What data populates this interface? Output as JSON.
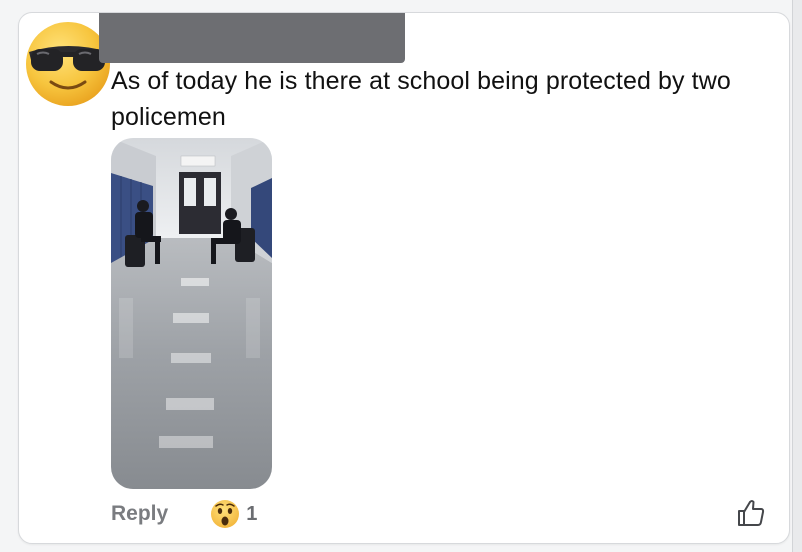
{
  "comment": {
    "text": "As of today he is there at school being protected by two policemen",
    "image_alt": "school hallway with two seated police officers",
    "reply_label": "Reply",
    "reaction": {
      "icon": "wow-emoji-icon",
      "count": "1"
    },
    "like_icon": "thumbs-up-icon"
  },
  "colors": {
    "avatar_face": "#f7c53e",
    "redaction": "#6d6e72",
    "muted_text": "#7a7c80"
  }
}
